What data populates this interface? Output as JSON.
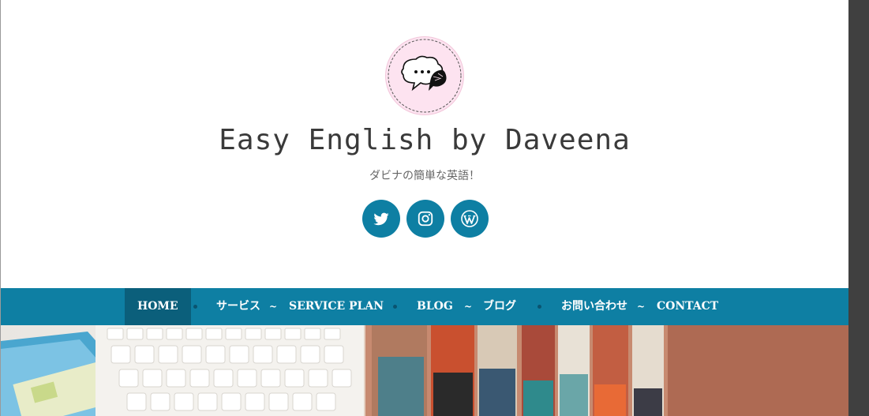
{
  "site": {
    "title": "Easy English by Daveena",
    "tagline": "ダビナの簡単な英語！"
  },
  "social": [
    {
      "name": "twitter",
      "icon": "twitter-icon"
    },
    {
      "name": "instagram",
      "icon": "instagram-icon"
    },
    {
      "name": "wordpress",
      "icon": "wordpress-icon"
    }
  ],
  "nav": {
    "home": "HOME",
    "services_jp": "サービス",
    "sep1": "~",
    "service_plan": "SERVICE PLAN",
    "blog": "BLOG",
    "sep2": "~",
    "blog_jp": "ブログ",
    "contact_jp": "お問い合わせ",
    "sep3": "~",
    "contact": "CONTACT"
  },
  "colors": {
    "nav_bg": "#0e7fa3",
    "nav_active": "#0b5f7b",
    "logo_bg": "#fde3f0",
    "title_text": "#3a3a3a"
  }
}
